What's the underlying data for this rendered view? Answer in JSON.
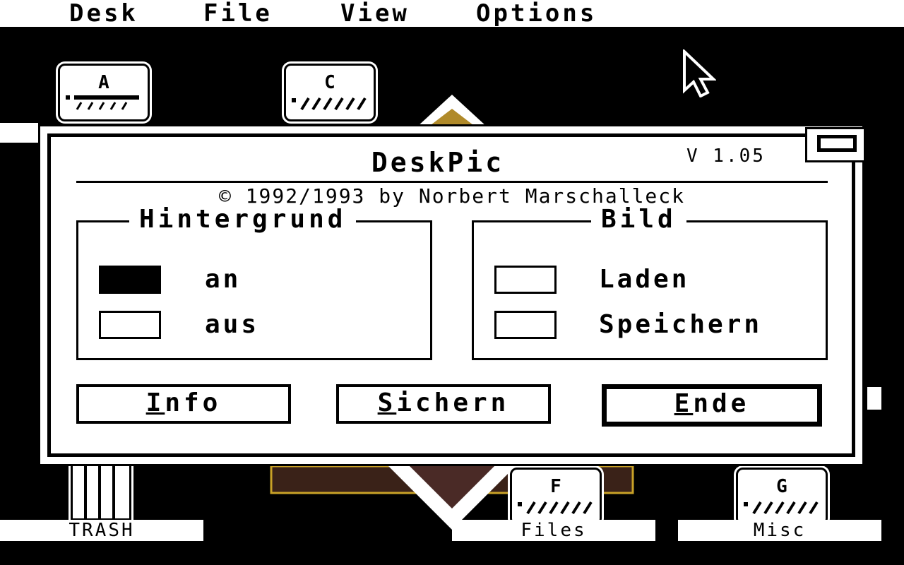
{
  "menu": [
    "Desk",
    "File",
    "View",
    "Options"
  ],
  "desktop": {
    "drives": [
      {
        "letter": "A"
      },
      {
        "letter": "C"
      },
      {
        "letter": "F"
      },
      {
        "letter": "G"
      }
    ],
    "labels": {
      "trash": "TRASH",
      "files": "Files",
      "misc": "Misc"
    }
  },
  "dialog": {
    "title": "DeskPic",
    "version": "V 1.05",
    "copyright": "© 1992/1993 by Norbert Marschalleck",
    "hintergrund": {
      "title": "Hintergrund",
      "options": [
        {
          "label": "an",
          "checked": true
        },
        {
          "label": "aus",
          "checked": false
        }
      ]
    },
    "bild": {
      "title": "Bild",
      "options": [
        {
          "label": "Laden",
          "checked": false
        },
        {
          "label": "Speichern",
          "checked": false
        }
      ]
    },
    "buttons": {
      "info": {
        "accel": "I",
        "rest": "nfo"
      },
      "sichern": {
        "accel": "S",
        "rest": "ichern"
      },
      "ende": {
        "accel": "E",
        "rest": "nde",
        "default": true
      }
    }
  }
}
